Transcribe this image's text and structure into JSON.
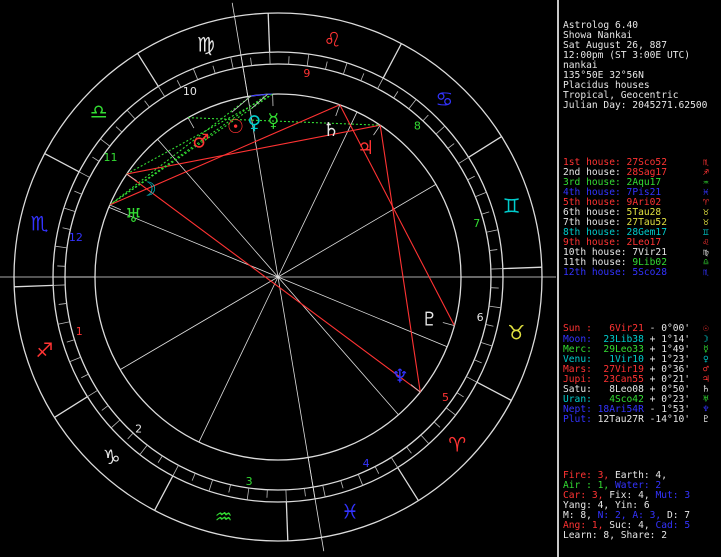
{
  "header": [
    "Astrolog 6.40",
    "Showa Nankai",
    "Sat August 26, 887",
    "12:00pm (ST 3:00E UTC)",
    "nankai",
    "135°50E 32°56N",
    "Placidus houses",
    "Tropical, Geocentric",
    "Julian Day: 2045271.62500"
  ],
  "houses": [
    {
      "label": "1st house: ",
      "value": "27Sco52",
      "glyph": "♏",
      "color": "#ff3333"
    },
    {
      "label": "2nd house: ",
      "value": "28Sag17",
      "glyph": "♐",
      "color": "#ff3333"
    },
    {
      "label": "3rd house: ",
      "value": "2Aqu17",
      "glyph": "♒",
      "color": "#33dd33"
    },
    {
      "label": "4th house: ",
      "value": "7Pis21",
      "glyph": "♓",
      "color": "#3333ff"
    },
    {
      "label": "5th house: ",
      "value": "9Ari02",
      "glyph": "♈",
      "color": "#ff3333"
    },
    {
      "label": "6th house: ",
      "value": "5Tau28",
      "glyph": "♉",
      "color": "#e0e040"
    },
    {
      "label": "7th house: ",
      "value": "27Tau52",
      "glyph": "♉",
      "color": "#e0e040"
    },
    {
      "label": "8th house: ",
      "value": "28Gem17",
      "glyph": "♊",
      "color": "#00cccc"
    },
    {
      "label": "9th house: ",
      "value": "2Leo17",
      "glyph": "♌",
      "color": "#ff3333"
    },
    {
      "label": "10th house: ",
      "value": "7Vir21",
      "glyph": "♍",
      "color": "#e6e6e6"
    },
    {
      "label": "11th house: ",
      "value": "9Lib02",
      "glyph": "♎",
      "color": "#33dd33"
    },
    {
      "label": "12th house: ",
      "value": "5Sco28",
      "glyph": "♏",
      "color": "#3333ff"
    }
  ],
  "house_label_colors": [
    "#ff3333",
    "#e6e6e6",
    "#33dd33",
    "#3333ff",
    "#ff3333",
    "#e6e6e6",
    "#e6e6e6",
    "#00cccc",
    "#ff3333",
    "#e6e6e6",
    "#e6e6e6",
    "#3333ff"
  ],
  "planets": [
    {
      "name": "Sun :",
      "pos": "6Vir21",
      "lat": "- 0°00'",
      "glyph": "☉",
      "color": "#ff3333",
      "ncolor": "#ff3333"
    },
    {
      "name": "Moon:",
      "pos": "23Lib38",
      "lat": "+ 1°14'",
      "glyph": "☽",
      "color": "#00cccc",
      "ncolor": "#3333ff"
    },
    {
      "name": "Merc:",
      "pos": "29Leo33",
      "lat": "+ 1°49'",
      "glyph": "☿",
      "color": "#33dd33",
      "ncolor": "#33dd33"
    },
    {
      "name": "Venu:",
      "pos": "1Vir10",
      "lat": "+ 1°23'",
      "glyph": "♀",
      "color": "#00cccc",
      "ncolor": "#00cccc"
    },
    {
      "name": "Mars:",
      "pos": "27Vir19",
      "lat": "+ 0°36'",
      "glyph": "♂",
      "color": "#ff3333",
      "ncolor": "#ff3333"
    },
    {
      "name": "Jupi:",
      "pos": "23Can55",
      "lat": "+ 0°21'",
      "glyph": "♃",
      "color": "#ff3333",
      "ncolor": "#ff3333"
    },
    {
      "name": "Satu:",
      "pos": "8Leo08",
      "lat": "+ 0°50'",
      "glyph": "♄",
      "color": "#e6e6e6",
      "ncolor": "#e6e6e6"
    },
    {
      "name": "Uran:",
      "pos": "4Sco42",
      "lat": "+ 0°23'",
      "glyph": "♅",
      "color": "#33dd33",
      "ncolor": "#00cccc"
    },
    {
      "name": "Nept:",
      "pos": "18Ari54R",
      "lat": "- 1°53'",
      "glyph": "♆",
      "color": "#3333ff",
      "ncolor": "#3333ff"
    },
    {
      "name": "Plut:",
      "pos": "12Tau27R",
      "lat": "-14°10'",
      "glyph": "♇",
      "color": "#e6e6e6",
      "ncolor": "#3333ff"
    }
  ],
  "summary": [
    [
      {
        "t": "Fire: 3, ",
        "c": "#ff3333"
      },
      {
        "t": "Earth: 4,",
        "c": "#e6e6e6"
      }
    ],
    [
      {
        "t": "Air : 1, ",
        "c": "#33dd33"
      },
      {
        "t": "Water: 2",
        "c": "#3333ff"
      }
    ],
    [
      {
        "t": "Car: 3, ",
        "c": "#ff3333"
      },
      {
        "t": "Fix: 4, ",
        "c": "#e6e6e6"
      },
      {
        "t": "Mut: 3",
        "c": "#3333ff"
      }
    ],
    [
      {
        "t": "Yang: 4, Yin: 6",
        "c": "#e6e6e6"
      }
    ],
    [
      {
        "t": "M: 8, ",
        "c": "#e6e6e6"
      },
      {
        "t": "N: 2, ",
        "c": "#3333ff"
      },
      {
        "t": "A: 3, ",
        "c": "#3333ff"
      },
      {
        "t": "D: 7",
        "c": "#e6e6e6"
      }
    ],
    [
      {
        "t": "Ang: 1, ",
        "c": "#ff3333"
      },
      {
        "t": "Suc: 4, ",
        "c": "#e6e6e6"
      },
      {
        "t": "Cad: 5",
        "c": "#3333ff"
      }
    ],
    [
      {
        "t": "Learn: 8, Share: 2",
        "c": "#e6e6e6"
      }
    ]
  ],
  "wheel": {
    "house_numbers": [
      "1",
      "2",
      "3",
      "4",
      "5",
      "6",
      "7",
      "8",
      "9",
      "10",
      "11",
      "12"
    ],
    "house_number_colors": [
      "#ff3333",
      "#e6e6e6",
      "#33dd33",
      "#3333ff",
      "#ff3333",
      "#e6e6e6",
      "#33dd33",
      "#33dd33",
      "#ff3333",
      "#e6e6e6",
      "#33dd33",
      "#3333ff"
    ],
    "signs": [
      {
        "glyph": "♈",
        "color": "#ff3333"
      },
      {
        "glyph": "♉",
        "color": "#e0e040"
      },
      {
        "glyph": "♊",
        "color": "#00cccc"
      },
      {
        "glyph": "♋",
        "color": "#3333ff"
      },
      {
        "glyph": "♌",
        "color": "#ff3333"
      },
      {
        "glyph": "♍",
        "color": "#e6e6e6"
      },
      {
        "glyph": "♎",
        "color": "#33dd33"
      },
      {
        "glyph": "♏",
        "color": "#3333ff"
      },
      {
        "glyph": "♐",
        "color": "#ff3333"
      },
      {
        "glyph": "♑",
        "color": "#e6e6e6"
      },
      {
        "glyph": "♒",
        "color": "#33dd33"
      },
      {
        "glyph": "♓",
        "color": "#3333ff"
      }
    ]
  }
}
